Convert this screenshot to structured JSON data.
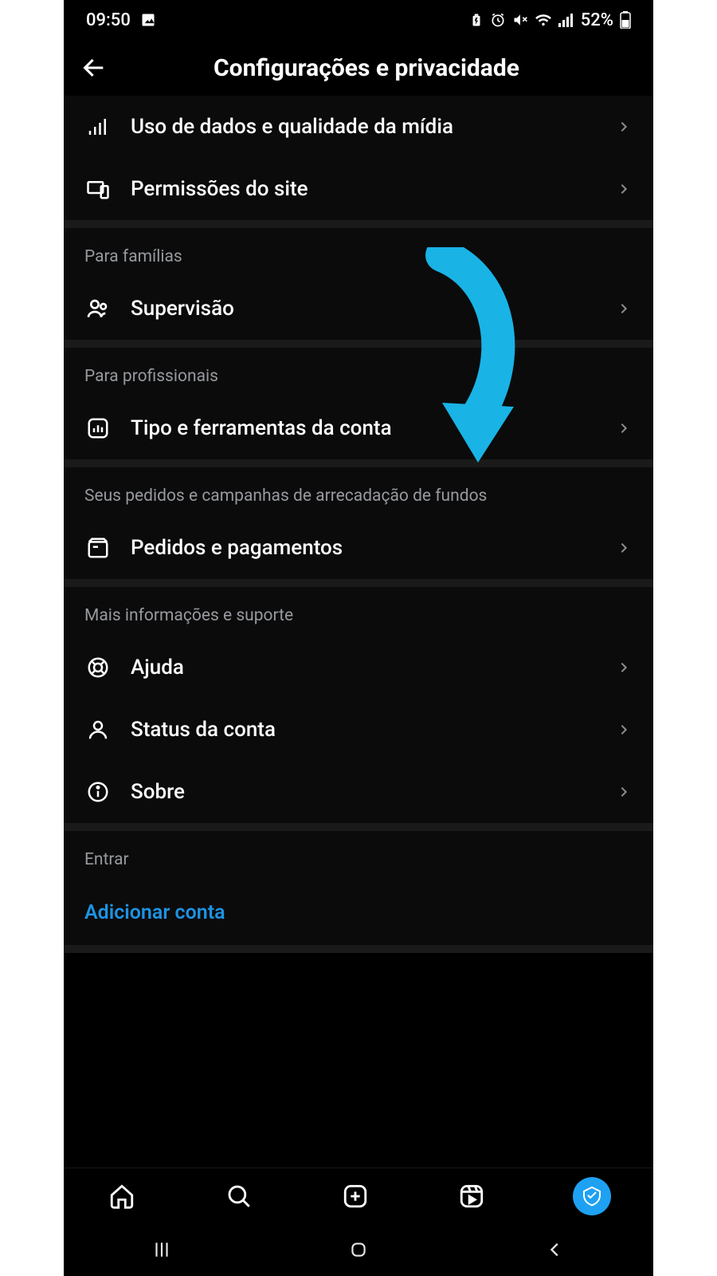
{
  "status": {
    "time": "09:50",
    "battery_text": "52%"
  },
  "header": {
    "title": "Configurações e privacidade"
  },
  "top_section": {
    "items": [
      {
        "label": "Uso de dados e qualidade da mídia"
      },
      {
        "label": "Permissões do site"
      }
    ]
  },
  "families": {
    "header": "Para famílias",
    "items": [
      {
        "label": "Supervisão"
      }
    ]
  },
  "pros": {
    "header": "Para profissionais",
    "items": [
      {
        "label": "Tipo e ferramentas da conta"
      }
    ]
  },
  "orders": {
    "header": "Seus pedidos e campanhas de arrecadação de fundos",
    "items": [
      {
        "label": "Pedidos e pagamentos"
      }
    ]
  },
  "support": {
    "header": "Mais informações e suporte",
    "items": [
      {
        "label": "Ajuda"
      },
      {
        "label": "Status da conta"
      },
      {
        "label": "Sobre"
      }
    ]
  },
  "login": {
    "header": "Entrar",
    "add_account": "Adicionar conta"
  }
}
